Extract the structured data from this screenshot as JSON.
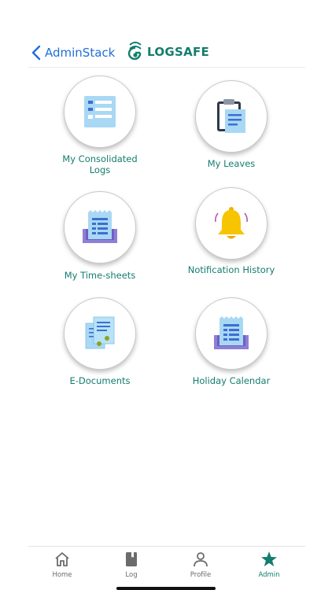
{
  "header": {
    "back_label": "AdminStack",
    "logo_text": "LOGSAFE"
  },
  "menu": {
    "items": [
      {
        "label": "My Consolidated Logs",
        "icon": "consolidated-logs-icon"
      },
      {
        "label": "My Leaves",
        "icon": "clipboard-icon"
      },
      {
        "label": "My Time-sheets",
        "icon": "timesheet-receipt-icon"
      },
      {
        "label": "Notification History",
        "icon": "bell-icon"
      },
      {
        "label": "E-Documents",
        "icon": "documents-icon"
      },
      {
        "label": "Holiday Calendar",
        "icon": "calendar-receipt-icon"
      }
    ]
  },
  "tabbar": {
    "tabs": [
      {
        "label": "Home",
        "icon": "home-icon",
        "active": false
      },
      {
        "label": "Log",
        "icon": "book-icon",
        "active": false
      },
      {
        "label": "Profile",
        "icon": "person-icon",
        "active": false
      },
      {
        "label": "Admin",
        "icon": "star-icon",
        "active": true
      }
    ]
  },
  "colors": {
    "accent": "#137d6e",
    "link": "#1e6fd9",
    "inactive_tab": "#6b6b6b"
  }
}
